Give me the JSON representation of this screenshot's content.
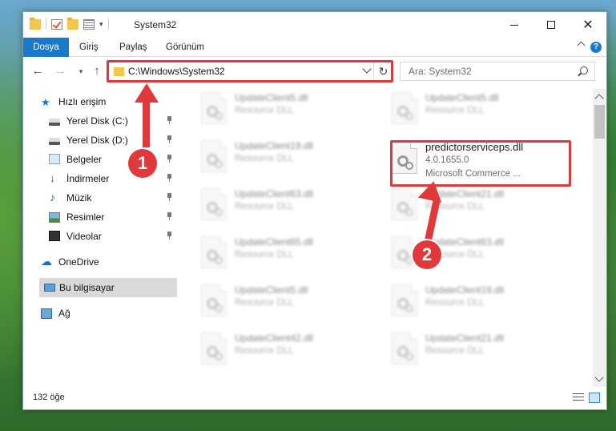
{
  "window": {
    "title": "System32"
  },
  "ribbon": {
    "tabs": [
      "Dosya",
      "Giriş",
      "Paylaş",
      "Görünüm"
    ],
    "help": "?"
  },
  "nav": {
    "address": "C:\\Windows\\System32",
    "search_placeholder": "Ara: System32"
  },
  "sidebar": {
    "items": [
      {
        "label": "Hızlı erişim",
        "icon": "star-icon"
      },
      {
        "label": "Yerel Disk (C:)",
        "icon": "disk-icon"
      },
      {
        "label": "Yerel Disk (D:)",
        "icon": "disk-icon"
      },
      {
        "label": "Belgeler",
        "icon": "documents-icon"
      },
      {
        "label": "İndirmeler",
        "icon": "download-icon"
      },
      {
        "label": "Müzik",
        "icon": "music-icon"
      },
      {
        "label": "Resimler",
        "icon": "pictures-icon"
      },
      {
        "label": "Videolar",
        "icon": "videos-icon"
      },
      {
        "label": "OneDrive",
        "icon": "cloud-icon"
      },
      {
        "label": "Bu bilgisayar",
        "icon": "this-pc-icon"
      },
      {
        "label": "Ağ",
        "icon": "network-icon"
      }
    ]
  },
  "files": [
    {
      "name": "UpdateClient5.dll",
      "type": "Resource DLL"
    },
    {
      "name": "UpdateClient5.dll",
      "type": "Resource DLL"
    },
    {
      "name": "UpdateClient19.dll",
      "type": "Resource DLL"
    },
    {
      "name": "predictorserviceps.dll",
      "version": "4.0.1655.0",
      "company": "Microsoft Commerce ..."
    },
    {
      "name": "UpdateClient63.dll",
      "type": "Resource DLL"
    },
    {
      "name": "UpdateClient21.dll",
      "type": "Resource DLL"
    },
    {
      "name": "UpdateClient65.dll",
      "type": "Resource DLL"
    },
    {
      "name": "UpdateClient63.dll",
      "type": "Resource DLL"
    },
    {
      "name": "UpdateClient5.dll",
      "type": "Resource DLL"
    },
    {
      "name": "UpdateClient19.dll",
      "type": "Resource DLL"
    },
    {
      "name": "UpdateClient42.dll",
      "type": "Resource DLL"
    },
    {
      "name": "UpdateClient21.dll",
      "type": "Resource DLL"
    }
  ],
  "status": {
    "item_count": "132 öğe"
  },
  "callouts": [
    "1",
    "2"
  ],
  "colors": {
    "accent": "#1979ca",
    "highlight": "#e0383b"
  }
}
